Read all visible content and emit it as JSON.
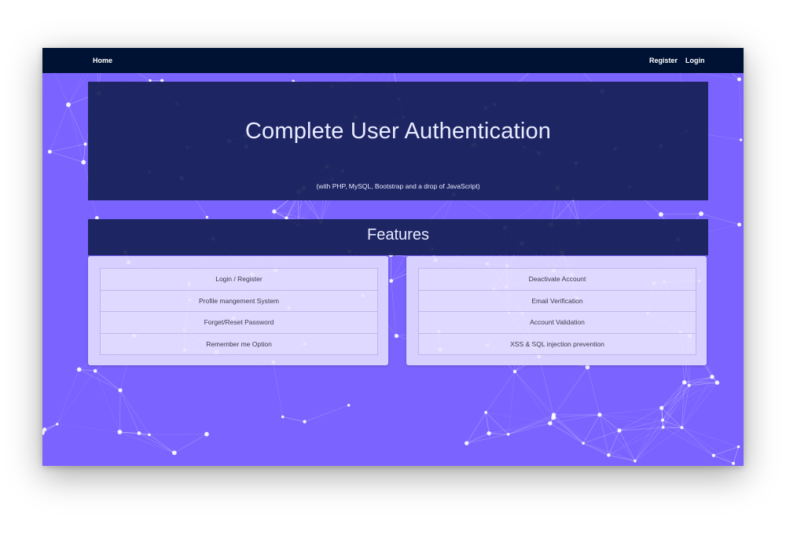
{
  "nav": {
    "home_label": "Home",
    "register_label": "Register",
    "login_label": "Login"
  },
  "hero": {
    "title": "Complete User Authentication",
    "subtitle": "(with PHP, MySQL, Bootstrap and a drop of JavaScript)"
  },
  "features": {
    "heading": "Features",
    "left_items": [
      "Login / Register",
      "Profile mangement System",
      "Forget/Reset Password",
      "Remember me Option"
    ],
    "right_items": [
      "Deactivate Account",
      "Email Verification",
      "Account Validation",
      "XSS & SQL injection prevention"
    ]
  },
  "colors": {
    "background": "#7a63ff",
    "navbar": "#001233",
    "panel": "#162056",
    "card": "#e8e2ff"
  }
}
